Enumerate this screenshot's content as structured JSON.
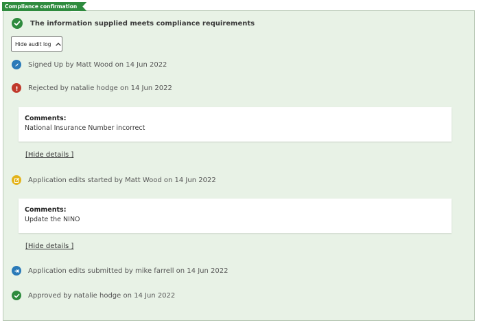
{
  "panel": {
    "tag_label": "Compliance confirmation",
    "heading": "The information supplied meets compliance requirements",
    "toggle_label": "Hide audit log"
  },
  "audit": {
    "e1": {
      "text": "Signed Up by Matt Wood on 14 Jun 2022",
      "icon": "compass-icon",
      "color": "#2a7ab8"
    },
    "e2": {
      "text": "Rejected by natalie hodge on 14 Jun 2022",
      "icon": "exclamation-icon",
      "color": "#c0392b"
    },
    "c1": {
      "label": "Comments:",
      "text": "National Insurance Number incorrect"
    },
    "d1": "[Hide details ]",
    "e3": {
      "text": "Application edits started by Matt Wood on 14 Jun 2022",
      "icon": "edit-icon",
      "color": "#e3b31b"
    },
    "c2": {
      "label": "Comments:",
      "text": "Update the NINO"
    },
    "d2": "[Hide details ]",
    "e4": {
      "text": "Application edits submitted by mike farrell on 14 Jun 2022",
      "icon": "submit-icon",
      "color": "#2a7ab8"
    },
    "e5": {
      "text": "Approved by natalie hodge on 14 Jun 2022",
      "icon": "check-icon",
      "color": "#2e8b3e"
    }
  }
}
